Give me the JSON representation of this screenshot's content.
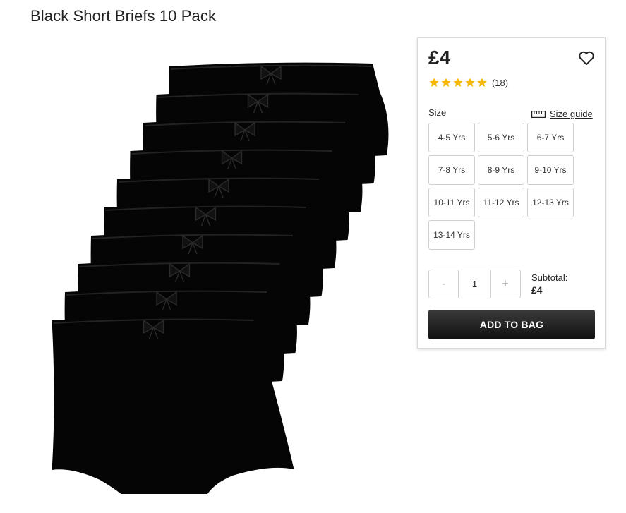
{
  "product": {
    "title": "Black Short Briefs 10 Pack"
  },
  "panel": {
    "price": "£4",
    "rating": {
      "value": 5,
      "max": 5,
      "count_label": "(18)"
    },
    "size_label": "Size",
    "size_guide_label": "Size guide",
    "sizes": [
      "4-5 Yrs",
      "5-6 Yrs",
      "6-7 Yrs",
      "7-8 Yrs",
      "8-9 Yrs",
      "9-10 Yrs",
      "10-11 Yrs",
      "11-12 Yrs",
      "12-13 Yrs",
      "13-14 Yrs"
    ],
    "quantity": {
      "minus": "-",
      "value": "1",
      "plus": "+"
    },
    "subtotal_label": "Subtotal:",
    "subtotal_value": "£4",
    "add_to_bag_label": "ADD TO BAG"
  },
  "colors": {
    "star": "#f5b800",
    "button": "#1a1a1a",
    "garment": "#050505"
  },
  "icons": {
    "wishlist": "heart-icon",
    "size_guide": "ruler-icon",
    "rating": "star-icon"
  }
}
